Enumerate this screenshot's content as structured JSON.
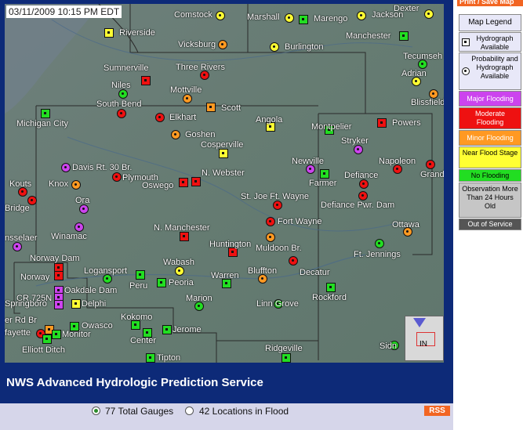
{
  "timestamp": "03/11/2009 10:15 PM EDT",
  "footer_title": "NWS Advanced Hydrologic Prediction Service",
  "gauge_filters": [
    {
      "label": "77 Total Gauges",
      "checked": true
    },
    {
      "label": "42 Locations in Flood",
      "checked": false
    }
  ],
  "rss_label": "RSS",
  "print_label": "Print / Save Map",
  "inset_label": "IN",
  "colors": {
    "major": "#cc44ee",
    "moderate": "#ee1111",
    "minor": "#ff9922",
    "near": "#ffff33",
    "none": "#22dd22",
    "old": "#c6c6c6",
    "out": "#555555"
  },
  "legend": {
    "title": "Map Legend",
    "hydrograph": "Hydrograph Available",
    "probability": "Probability and Hydrograph Available",
    "categories": [
      {
        "key": "major",
        "label": "Major Flooding",
        "text_color": "#ffffff"
      },
      {
        "key": "moderate",
        "label": "Moderate Flooding",
        "text_color": "#ffffff"
      },
      {
        "key": "minor",
        "label": "Minor Flooding",
        "text_color": "#ffffff"
      },
      {
        "key": "near",
        "label": "Near Flood Stage",
        "text_color": "#000000"
      },
      {
        "key": "none",
        "label": "No Flooding",
        "text_color": "#000000"
      },
      {
        "key": "old",
        "label": "Observation More Than 24 Hours Old",
        "text_color": "#000000"
      },
      {
        "key": "out",
        "label": "Out of Service",
        "text_color": "#ffffff"
      }
    ]
  },
  "gauges": [
    {
      "name": "Comstock",
      "status": "near",
      "shape": "circle"
    },
    {
      "name": "Marshall",
      "status": "near",
      "shape": "circle"
    },
    {
      "name": "Marengo",
      "status": "none",
      "shape": "square"
    },
    {
      "name": "Jackson",
      "status": "near",
      "shape": "circle"
    },
    {
      "name": "Dexter",
      "status": "near",
      "shape": "circle"
    },
    {
      "name": "Riverside",
      "status": "near",
      "shape": "square"
    },
    {
      "name": "Vicksburg",
      "status": "minor",
      "shape": "circle"
    },
    {
      "name": "Burlington",
      "status": "near",
      "shape": "circle"
    },
    {
      "name": "Manchester",
      "status": "none",
      "shape": "square"
    },
    {
      "name": "Tecumseh",
      "status": "none",
      "shape": "circle"
    },
    {
      "name": "Adrian",
      "status": "near",
      "shape": "circle"
    },
    {
      "name": "Blissfield",
      "status": "minor",
      "shape": "circle"
    },
    {
      "name": "Sumnerville",
      "status": "moderate",
      "shape": "square"
    },
    {
      "name": "Three Rivers",
      "status": "moderate",
      "shape": "circle"
    },
    {
      "name": "Niles",
      "status": "none",
      "shape": "circle"
    },
    {
      "name": "Mottville",
      "status": "minor",
      "shape": "circle"
    },
    {
      "name": "South Bend",
      "status": "moderate",
      "shape": "circle"
    },
    {
      "name": "Scott",
      "status": "minor",
      "shape": "square"
    },
    {
      "name": "Michigan City",
      "status": "none",
      "shape": "square"
    },
    {
      "name": "Elkhart",
      "status": "moderate",
      "shape": "circle"
    },
    {
      "name": "Angola",
      "status": "near",
      "shape": "square"
    },
    {
      "name": "Montpelier",
      "status": "none",
      "shape": "square"
    },
    {
      "name": "Powers",
      "status": "moderate",
      "shape": "square"
    },
    {
      "name": "Goshen",
      "status": "minor",
      "shape": "circle"
    },
    {
      "name": "Stryker",
      "status": "major",
      "shape": "circle"
    },
    {
      "name": "Cosperville",
      "status": "near",
      "shape": "square"
    },
    {
      "name": "Davis Rt. 30 Br.",
      "status": "major",
      "shape": "circle"
    },
    {
      "name": "Newville",
      "status": "major",
      "shape": "circle"
    },
    {
      "name": "Napoleon",
      "status": "moderate",
      "shape": "circle"
    },
    {
      "name": "Grand",
      "status": "moderate",
      "shape": "circle"
    },
    {
      "name": "Plymouth",
      "status": "moderate",
      "shape": "circle"
    },
    {
      "name": "N. Webster",
      "status": "moderate",
      "shape": "square"
    },
    {
      "name": "Oswego",
      "status": "moderate",
      "shape": "square"
    },
    {
      "name": "Farmer",
      "status": "none",
      "shape": "square"
    },
    {
      "name": "Defiance",
      "status": "moderate",
      "shape": "circle"
    },
    {
      "name": "Knox",
      "status": "minor",
      "shape": "circle"
    },
    {
      "name": "Kouts",
      "status": "moderate",
      "shape": "circle"
    },
    {
      "name": "Bridge",
      "status": "moderate",
      "shape": "circle"
    },
    {
      "name": "St. Joe Ft. Wayne",
      "status": "moderate",
      "shape": "circle"
    },
    {
      "name": "Defiance Pwr. Dam",
      "status": "moderate",
      "shape": "circle"
    },
    {
      "name": "Ora",
      "status": "major",
      "shape": "circle"
    },
    {
      "name": "Fort Wayne",
      "status": "moderate",
      "shape": "circle"
    },
    {
      "name": "Winamac",
      "status": "major",
      "shape": "circle"
    },
    {
      "name": "Ottawa",
      "status": "minor",
      "shape": "circle"
    },
    {
      "name": "N. Manchester",
      "status": "moderate",
      "shape": "square"
    },
    {
      "name": "nsselaer",
      "status": "major",
      "shape": "circle"
    },
    {
      "name": "Huntington",
      "status": "moderate",
      "shape": "square"
    },
    {
      "name": "Muldoon Br.",
      "status": "minor",
      "shape": "circle"
    },
    {
      "name": "Ft. Jennings",
      "status": "none",
      "shape": "circle"
    },
    {
      "name": "Norway Dam",
      "status": "moderate",
      "shape": "square"
    },
    {
      "name": "Wabash",
      "status": "near",
      "shape": "circle"
    },
    {
      "name": "Logansport",
      "status": "none",
      "shape": "circle"
    },
    {
      "name": "Decatur",
      "status": "moderate",
      "shape": "circle"
    },
    {
      "name": "Norway",
      "status": "moderate",
      "shape": "square"
    },
    {
      "name": "Bluffton",
      "status": "minor",
      "shape": "circle"
    },
    {
      "name": "Warren",
      "status": "none",
      "shape": "square"
    },
    {
      "name": "Peru",
      "status": "none",
      "shape": "square"
    },
    {
      "name": "Peoria",
      "status": "none",
      "shape": "square"
    },
    {
      "name": "Oakdale Dam",
      "status": "major",
      "shape": "square"
    },
    {
      "name": "Rockford",
      "status": "none",
      "shape": "square"
    },
    {
      "name": "CR 725N",
      "status": "major",
      "shape": "square"
    },
    {
      "name": "Springboro",
      "status": "major",
      "shape": "square"
    },
    {
      "name": "Delphi",
      "status": "near",
      "shape": "square"
    },
    {
      "name": "Marion",
      "status": "none",
      "shape": "circle"
    },
    {
      "name": "Linn Grove",
      "status": "none",
      "shape": "circle"
    },
    {
      "name": "er Rd Br",
      "status": "minor",
      "shape": "square"
    },
    {
      "name": "Kokomo",
      "status": "none",
      "shape": "square"
    },
    {
      "name": "Owasco",
      "status": "none",
      "shape": "square"
    },
    {
      "name": "fayette",
      "status": "moderate",
      "shape": "circle"
    },
    {
      "name": "Monitor",
      "status": "none",
      "shape": "square"
    },
    {
      "name": "Jerome",
      "status": "none",
      "shape": "square"
    },
    {
      "name": "Center",
      "status": "none",
      "shape": "square"
    },
    {
      "name": "Elliott Ditch",
      "status": "none",
      "shape": "square"
    },
    {
      "name": "Ridgeville",
      "status": "none",
      "shape": "square"
    },
    {
      "name": "Sidn",
      "status": "none",
      "shape": "circle"
    },
    {
      "name": "Tipton",
      "status": "none",
      "shape": "square"
    }
  ]
}
